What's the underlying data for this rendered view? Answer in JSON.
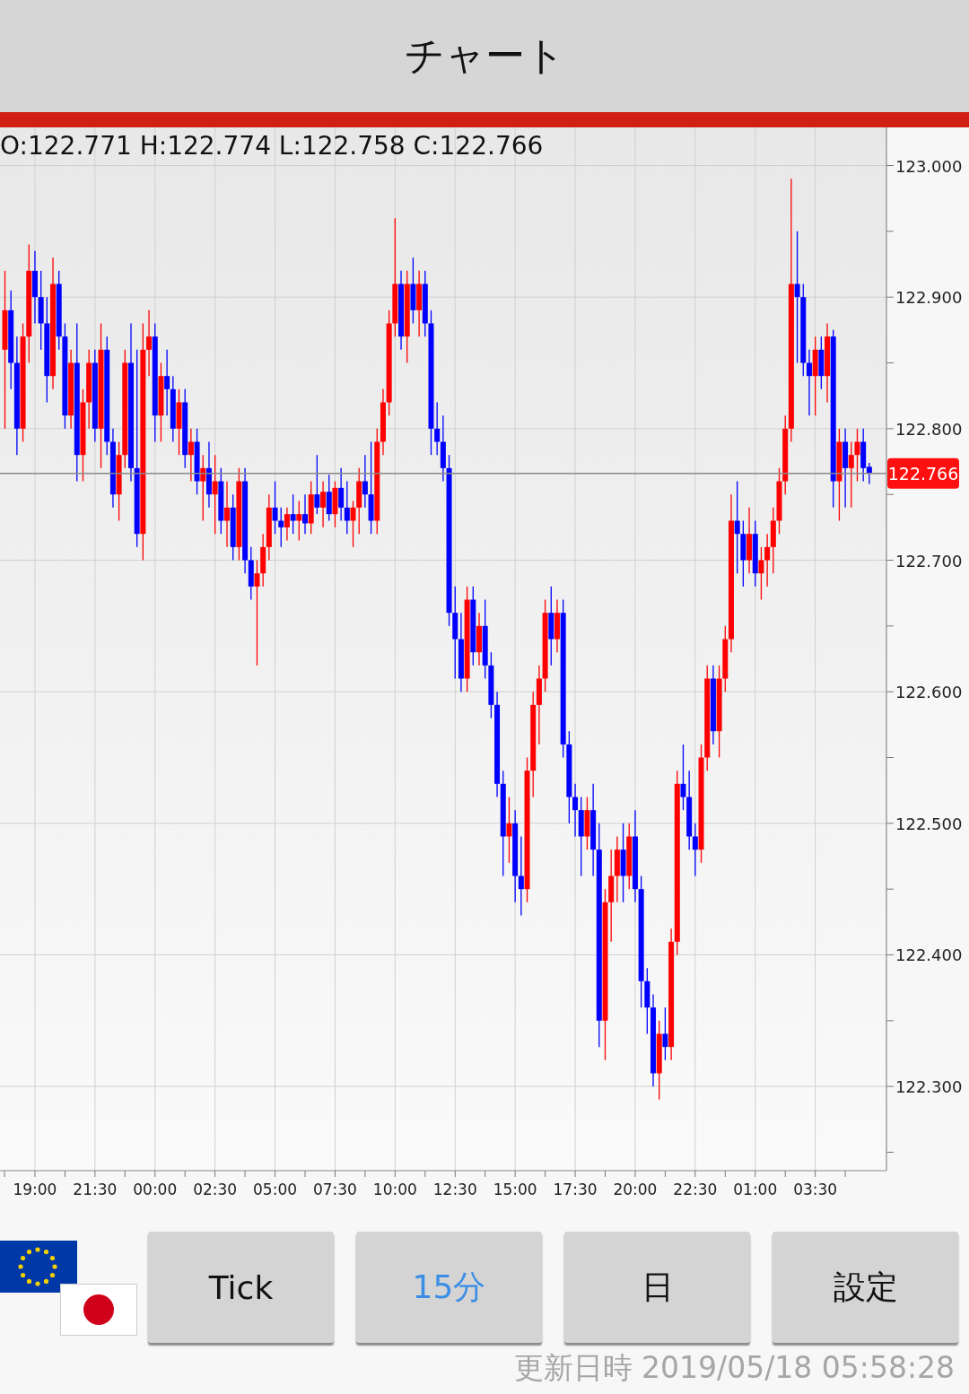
{
  "header": {
    "title": "チャート"
  },
  "chart": {
    "ohlc_readout": "O:122.771 H:122.774 L:122.758 C:122.766",
    "x_axis_labels": [
      "19:00",
      "21:30",
      "00:00",
      "02:30",
      "05:00",
      "07:30",
      "10:00",
      "12:30",
      "15:00",
      "17:30",
      "20:00",
      "22:30",
      "01:00",
      "03:30"
    ],
    "chart_data": {
      "type": "candlestick",
      "grid": true,
      "ylim": [
        122.236,
        123.029
      ],
      "ref_lines": [
        {
          "axis": "y",
          "value": 122.766,
          "label": "122.766"
        }
      ],
      "yticks": [
        {
          "value": 123.0,
          "label": "123.000"
        },
        {
          "value": 122.9,
          "label": "122.900"
        },
        {
          "value": 122.8,
          "label": "122.800"
        },
        {
          "value": 122.7,
          "label": "122.700"
        },
        {
          "value": 122.6,
          "label": "122.600"
        },
        {
          "value": 122.5,
          "label": "122.500"
        },
        {
          "value": 122.4,
          "label": "122.400"
        },
        {
          "value": 122.3,
          "label": "122.300"
        }
      ],
      "ohlc": [
        [
          122.86,
          122.92,
          122.8,
          122.89
        ],
        [
          122.89,
          122.905,
          122.83,
          122.85
        ],
        [
          122.85,
          122.87,
          122.78,
          122.8
        ],
        [
          122.8,
          122.88,
          122.79,
          122.87
        ],
        [
          122.87,
          122.94,
          122.85,
          122.92
        ],
        [
          122.92,
          122.935,
          122.88,
          122.9
        ],
        [
          122.9,
          122.92,
          122.86,
          122.88
        ],
        [
          122.88,
          122.9,
          122.82,
          122.84
        ],
        [
          122.84,
          122.93,
          122.83,
          122.91
        ],
        [
          122.91,
          122.92,
          122.86,
          122.87
        ],
        [
          122.87,
          122.88,
          122.8,
          122.81
        ],
        [
          122.81,
          122.86,
          122.8,
          122.85
        ],
        [
          122.85,
          122.88,
          122.76,
          122.78
        ],
        [
          122.78,
          122.83,
          122.76,
          122.82
        ],
        [
          122.82,
          122.86,
          122.8,
          122.85
        ],
        [
          122.85,
          122.86,
          122.79,
          122.8
        ],
        [
          122.8,
          122.88,
          122.77,
          122.86
        ],
        [
          122.86,
          122.87,
          122.78,
          122.79
        ],
        [
          122.79,
          122.8,
          122.74,
          122.75
        ],
        [
          122.75,
          122.79,
          122.73,
          122.78
        ],
        [
          122.78,
          122.86,
          122.77,
          122.85
        ],
        [
          122.85,
          122.88,
          122.76,
          122.77
        ],
        [
          122.77,
          122.86,
          122.71,
          122.72
        ],
        [
          122.72,
          122.88,
          122.7,
          122.86
        ],
        [
          122.86,
          122.89,
          122.84,
          122.87
        ],
        [
          122.87,
          122.88,
          122.79,
          122.81
        ],
        [
          122.81,
          122.85,
          122.79,
          122.84
        ],
        [
          122.84,
          122.86,
          122.81,
          122.83
        ],
        [
          122.83,
          122.84,
          122.79,
          122.8
        ],
        [
          122.8,
          122.83,
          122.78,
          122.82
        ],
        [
          122.82,
          122.83,
          122.77,
          122.78
        ],
        [
          122.78,
          122.8,
          122.76,
          122.79
        ],
        [
          122.79,
          122.8,
          122.75,
          122.76
        ],
        [
          122.76,
          122.78,
          122.73,
          122.77
        ],
        [
          122.77,
          122.79,
          122.74,
          122.75
        ],
        [
          122.75,
          122.78,
          122.72,
          122.76
        ],
        [
          122.76,
          122.77,
          122.72,
          122.73
        ],
        [
          122.73,
          122.76,
          122.71,
          122.74
        ],
        [
          122.74,
          122.75,
          122.7,
          122.71
        ],
        [
          122.71,
          122.77,
          122.7,
          122.76
        ],
        [
          122.76,
          122.77,
          122.69,
          122.7
        ],
        [
          122.7,
          122.71,
          122.67,
          122.68
        ],
        [
          122.68,
          122.7,
          122.62,
          122.69
        ],
        [
          122.69,
          122.72,
          122.68,
          122.71
        ],
        [
          122.71,
          122.75,
          122.7,
          122.74
        ],
        [
          122.74,
          122.76,
          122.72,
          122.73
        ],
        [
          122.73,
          122.74,
          122.71,
          122.725
        ],
        [
          122.725,
          122.74,
          122.715,
          122.735
        ],
        [
          122.735,
          122.75,
          122.72,
          122.73
        ],
        [
          122.73,
          122.745,
          122.715,
          122.735
        ],
        [
          122.735,
          122.75,
          122.72,
          122.728
        ],
        [
          122.728,
          122.76,
          122.72,
          122.75
        ],
        [
          122.75,
          122.78,
          122.735,
          122.74
        ],
        [
          122.74,
          122.76,
          122.725,
          122.752
        ],
        [
          122.752,
          122.765,
          122.73,
          122.735
        ],
        [
          122.735,
          122.76,
          122.725,
          122.755
        ],
        [
          122.755,
          122.77,
          122.73,
          122.74
        ],
        [
          122.74,
          122.76,
          122.72,
          122.73
        ],
        [
          122.73,
          122.745,
          122.71,
          122.74
        ],
        [
          122.74,
          122.77,
          122.72,
          122.76
        ],
        [
          122.76,
          122.78,
          122.74,
          122.75
        ],
        [
          122.75,
          122.79,
          122.72,
          122.73
        ],
        [
          122.73,
          122.8,
          122.72,
          122.79
        ],
        [
          122.79,
          122.83,
          122.78,
          122.82
        ],
        [
          122.82,
          122.89,
          122.81,
          122.88
        ],
        [
          122.88,
          122.96,
          122.87,
          122.91
        ],
        [
          122.91,
          122.92,
          122.86,
          122.87
        ],
        [
          122.87,
          122.92,
          122.85,
          122.91
        ],
        [
          122.91,
          122.93,
          122.88,
          122.89
        ],
        [
          122.89,
          122.92,
          122.87,
          122.91
        ],
        [
          122.91,
          122.92,
          122.87,
          122.88
        ],
        [
          122.88,
          122.89,
          122.78,
          122.8
        ],
        [
          122.8,
          122.82,
          122.78,
          122.79
        ],
        [
          122.79,
          122.81,
          122.76,
          122.77
        ],
        [
          122.77,
          122.78,
          122.65,
          122.66
        ],
        [
          122.66,
          122.68,
          122.61,
          122.64
        ],
        [
          122.64,
          122.66,
          122.6,
          122.61
        ],
        [
          122.61,
          122.68,
          122.6,
          122.67
        ],
        [
          122.67,
          122.68,
          122.62,
          122.63
        ],
        [
          122.63,
          122.66,
          122.62,
          122.65
        ],
        [
          122.65,
          122.67,
          122.61,
          122.62
        ],
        [
          122.62,
          122.63,
          122.58,
          122.59
        ],
        [
          122.59,
          122.6,
          122.52,
          122.53
        ],
        [
          122.53,
          122.54,
          122.46,
          122.49
        ],
        [
          122.49,
          122.52,
          122.47,
          122.5
        ],
        [
          122.5,
          122.51,
          122.44,
          122.46
        ],
        [
          122.46,
          122.49,
          122.43,
          122.45
        ],
        [
          122.45,
          122.55,
          122.44,
          122.54
        ],
        [
          122.54,
          122.6,
          122.52,
          122.59
        ],
        [
          122.59,
          122.62,
          122.56,
          122.61
        ],
        [
          122.61,
          122.67,
          122.6,
          122.66
        ],
        [
          122.66,
          122.68,
          122.62,
          122.64
        ],
        [
          122.64,
          122.67,
          122.63,
          122.66
        ],
        [
          122.66,
          122.67,
          122.55,
          122.56
        ],
        [
          122.56,
          122.57,
          122.5,
          122.52
        ],
        [
          122.52,
          122.53,
          122.49,
          122.51
        ],
        [
          122.51,
          122.52,
          122.46,
          122.49
        ],
        [
          122.49,
          122.52,
          122.48,
          122.51
        ],
        [
          122.51,
          122.53,
          122.46,
          122.48
        ],
        [
          122.48,
          122.5,
          122.33,
          122.35
        ],
        [
          122.35,
          122.45,
          122.32,
          122.44
        ],
        [
          122.44,
          122.48,
          122.41,
          122.46
        ],
        [
          122.46,
          122.49,
          122.44,
          122.48
        ],
        [
          122.48,
          122.5,
          122.44,
          122.46
        ],
        [
          122.46,
          122.5,
          122.45,
          122.49
        ],
        [
          122.49,
          122.51,
          122.44,
          122.45
        ],
        [
          122.45,
          122.46,
          122.36,
          122.38
        ],
        [
          122.38,
          122.39,
          122.34,
          122.36
        ],
        [
          122.36,
          122.37,
          122.3,
          122.31
        ],
        [
          122.31,
          122.35,
          122.29,
          122.34
        ],
        [
          122.34,
          122.36,
          122.32,
          122.33
        ],
        [
          122.33,
          122.42,
          122.32,
          122.41
        ],
        [
          122.41,
          122.54,
          122.4,
          122.53
        ],
        [
          122.53,
          122.56,
          122.51,
          122.52
        ],
        [
          122.52,
          122.54,
          122.48,
          122.49
        ],
        [
          122.49,
          122.5,
          122.46,
          122.48
        ],
        [
          122.48,
          122.56,
          122.47,
          122.55
        ],
        [
          122.55,
          122.62,
          122.54,
          122.61
        ],
        [
          122.61,
          122.62,
          122.56,
          122.57
        ],
        [
          122.57,
          122.62,
          122.55,
          122.61
        ],
        [
          122.61,
          122.65,
          122.6,
          122.64
        ],
        [
          122.64,
          122.75,
          122.63,
          122.73
        ],
        [
          122.73,
          122.76,
          122.69,
          122.72
        ],
        [
          122.72,
          122.73,
          122.68,
          122.7
        ],
        [
          122.7,
          122.74,
          122.69,
          122.72
        ],
        [
          122.72,
          122.73,
          122.68,
          122.69
        ],
        [
          122.69,
          122.71,
          122.67,
          122.7
        ],
        [
          122.7,
          122.72,
          122.68,
          122.71
        ],
        [
          122.71,
          122.74,
          122.69,
          122.73
        ],
        [
          122.73,
          122.77,
          122.72,
          122.76
        ],
        [
          122.76,
          122.81,
          122.75,
          122.8
        ],
        [
          122.8,
          122.99,
          122.79,
          122.91
        ],
        [
          122.91,
          122.95,
          122.85,
          122.9
        ],
        [
          122.9,
          122.91,
          122.84,
          122.85
        ],
        [
          122.85,
          122.86,
          122.81,
          122.84
        ],
        [
          122.84,
          122.87,
          122.81,
          122.86
        ],
        [
          122.86,
          122.87,
          122.83,
          122.84
        ],
        [
          122.84,
          122.88,
          122.82,
          122.87
        ],
        [
          122.87,
          122.875,
          122.74,
          122.76
        ],
        [
          122.76,
          122.8,
          122.73,
          122.79
        ],
        [
          122.79,
          122.8,
          122.74,
          122.77
        ],
        [
          122.77,
          122.79,
          122.74,
          122.78
        ],
        [
          122.78,
          122.8,
          122.76,
          122.79
        ],
        [
          122.79,
          122.8,
          122.76,
          122.77
        ],
        [
          122.771,
          122.774,
          122.758,
          122.766
        ]
      ]
    }
  },
  "period_tabs": [
    {
      "label": "Tick",
      "selected": false
    },
    {
      "label": "15分",
      "selected": true
    },
    {
      "label": "日",
      "selected": false
    }
  ],
  "settings_button": "設定",
  "updated": "更新日時 2019/05/18 05:58:28"
}
